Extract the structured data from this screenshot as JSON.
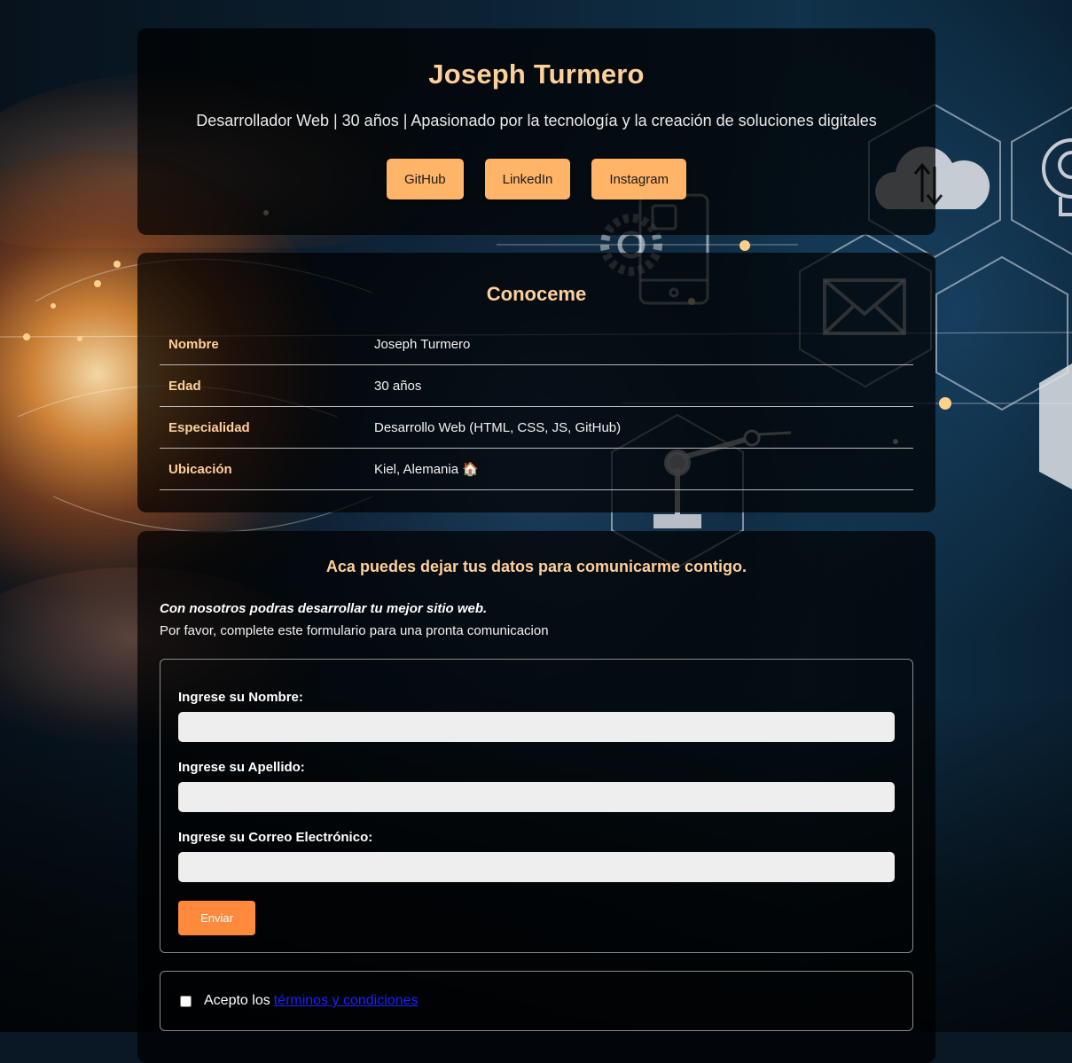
{
  "hero": {
    "name": "Joseph Turmero",
    "tagline": "Desarrollador Web | 30 años | Apasionado por la tecnología y la creación de soluciones digitales",
    "social_buttons": [
      {
        "label": "GitHub"
      },
      {
        "label": "LinkedIn"
      },
      {
        "label": "Instagram"
      }
    ]
  },
  "about": {
    "title": "Conoceme",
    "rows": [
      {
        "key": "Nombre",
        "value": "Joseph Turmero"
      },
      {
        "key": "Edad",
        "value": "30 años"
      },
      {
        "key": "Especialidad",
        "value": "Desarrollo Web (HTML, CSS, JS, GitHub)"
      },
      {
        "key": "Ubicación",
        "value": "Kiel, Alemania 🏠"
      }
    ]
  },
  "contact": {
    "title": "Aca puedes dejar tus datos para comunicarme contigo.",
    "intro_emphasis": "Con nosotros podras desarrollar tu mejor sitio web.",
    "intro_text": "Por favor, complete este formulario para una pronta comunicacion",
    "fields": [
      {
        "label": "Ingrese su Nombre:",
        "value": ""
      },
      {
        "label": "Ingrese su Apellido:",
        "value": ""
      },
      {
        "label": "Ingrese su Correo Electrónico:",
        "value": ""
      }
    ],
    "submit_label": "Enviar",
    "terms_prefix": "Acepto los",
    "terms_link": "términos y condiciones",
    "terms_checked": false
  },
  "colors": {
    "accent": "#ffcf9a",
    "button": "#ffb468",
    "submit": "#ff8a3d",
    "link": "#1a22ff"
  },
  "icons": [
    "cloud-sync-icon",
    "lightbulb-gear-icon",
    "mail-icon",
    "mobile-phone-icon",
    "gear-icon",
    "robot-arm-icon"
  ]
}
